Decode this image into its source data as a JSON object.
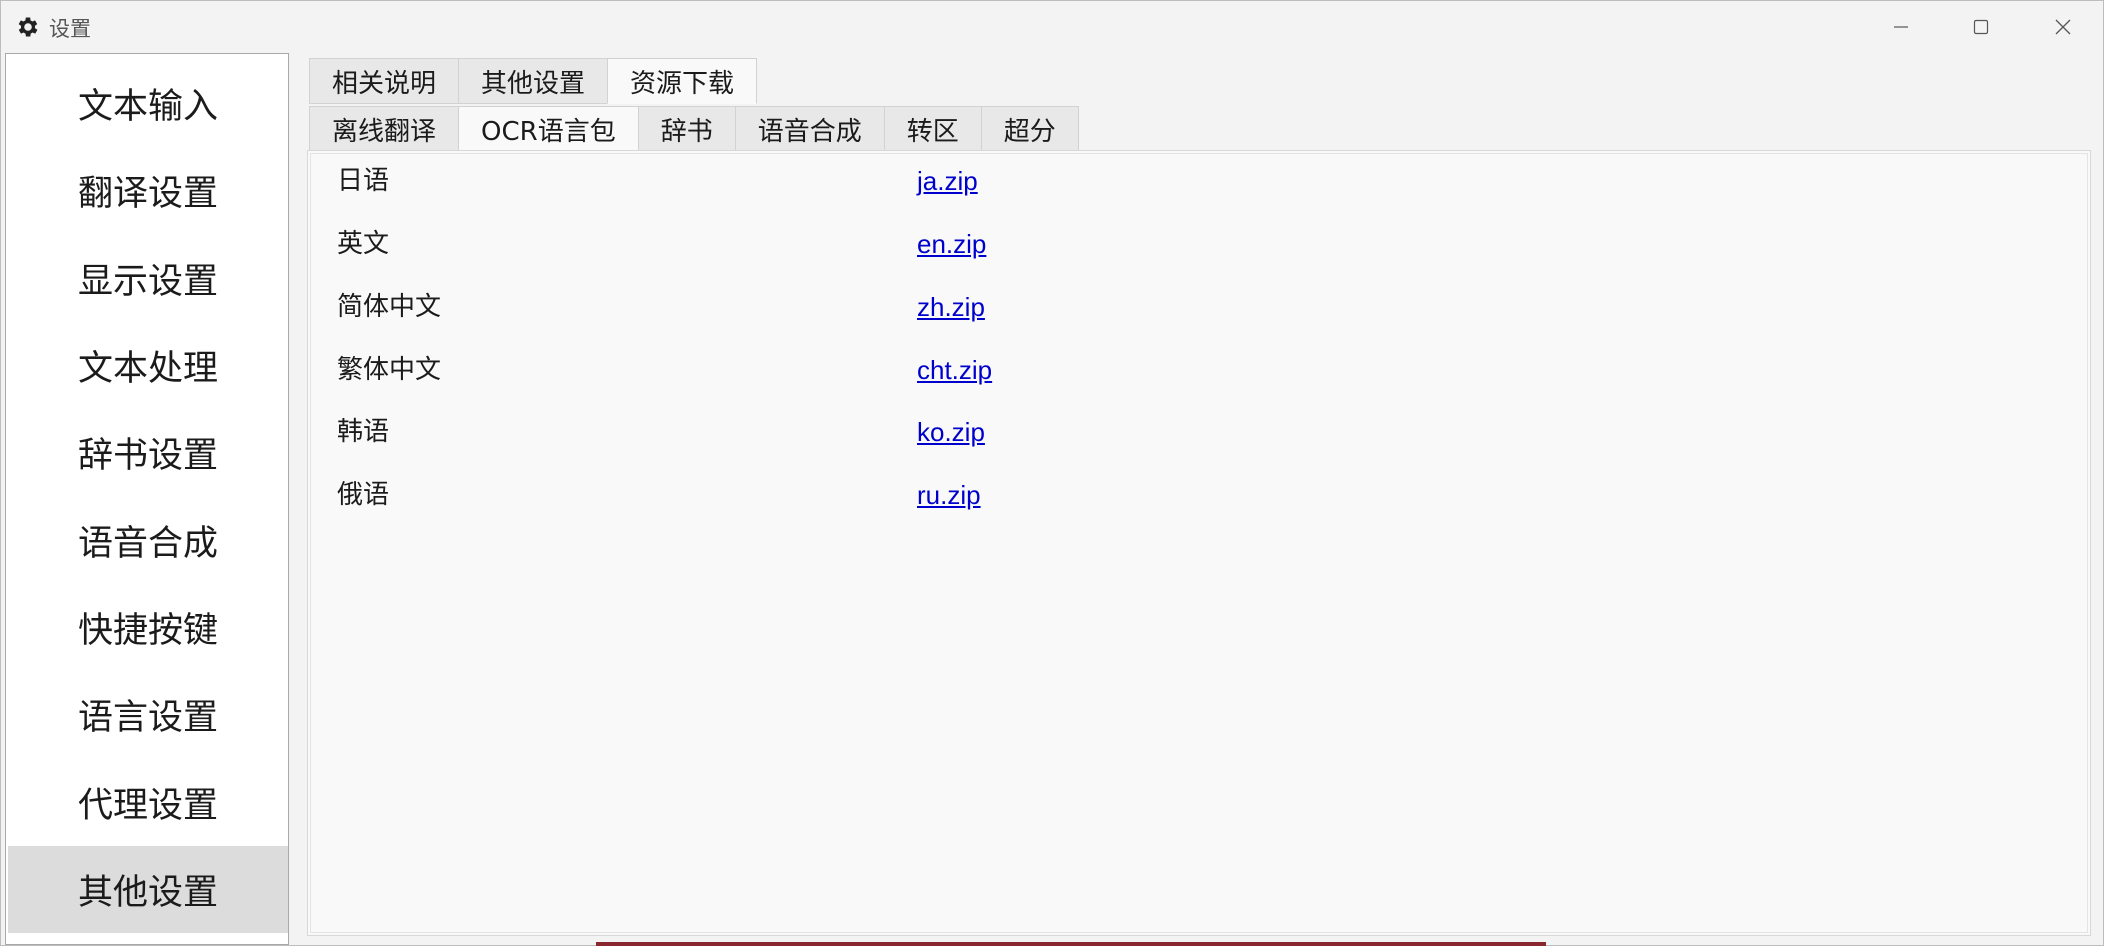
{
  "window": {
    "title": "设置",
    "app_icon": "gear-icon",
    "controls": [
      "minimize-icon",
      "maximize-icon",
      "close-icon"
    ]
  },
  "sidebar": {
    "items": [
      {
        "label": "文本输入",
        "active": false
      },
      {
        "label": "翻译设置",
        "active": false
      },
      {
        "label": "显示设置",
        "active": false
      },
      {
        "label": "文本处理",
        "active": false
      },
      {
        "label": "辞书设置",
        "active": false
      },
      {
        "label": "语音合成",
        "active": false
      },
      {
        "label": "快捷按键",
        "active": false
      },
      {
        "label": "语言设置",
        "active": false
      },
      {
        "label": "代理设置",
        "active": false
      },
      {
        "label": "其他设置",
        "active": true
      }
    ]
  },
  "top_tabs": [
    {
      "label": "相关说明",
      "active": false
    },
    {
      "label": "其他设置",
      "active": false
    },
    {
      "label": "资源下载",
      "active": true
    }
  ],
  "sub_tabs": [
    {
      "label": "离线翻译",
      "active": false
    },
    {
      "label": "OCR语言包",
      "active": true
    },
    {
      "label": "辞书",
      "active": false
    },
    {
      "label": "语音合成",
      "active": false
    },
    {
      "label": "转区",
      "active": false
    },
    {
      "label": "超分",
      "active": false
    }
  ],
  "ocr_packages": [
    {
      "language": "日语",
      "file": "ja.zip"
    },
    {
      "language": "英文",
      "file": "en.zip"
    },
    {
      "language": "简体中文",
      "file": "zh.zip"
    },
    {
      "language": "繁体中文",
      "file": "cht.zip"
    },
    {
      "language": "韩语",
      "file": "ko.zip"
    },
    {
      "language": "俄语",
      "file": "ru.zip"
    }
  ],
  "colors": {
    "link": "#0000cc",
    "active_nav": "#dcdcdc",
    "window_bg": "#f3f3f3"
  }
}
